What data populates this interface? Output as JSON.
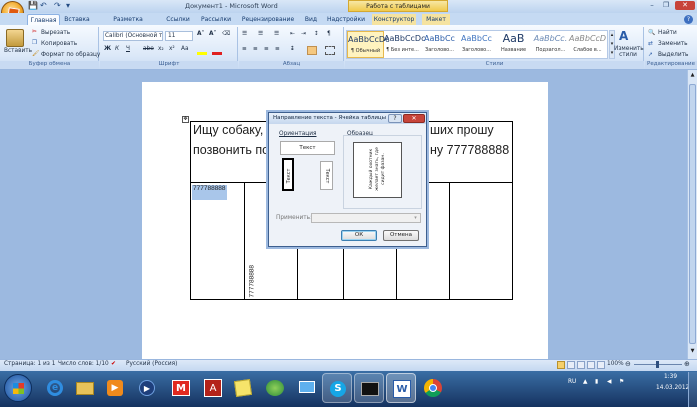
{
  "title_bar": {
    "window_title": "Документ1 - Microsoft Word",
    "context_tab_title": "Работа с таблицами",
    "minimize": "–",
    "restore": "❐",
    "close": "✕"
  },
  "ribbon_tabs": [
    "Главная",
    "Вставка",
    "Разметка страницы",
    "Ссылки",
    "Рассылки",
    "Рецензирование",
    "Вид",
    "Надстройки",
    "Конструктор",
    "Макет"
  ],
  "clipboard": {
    "paste": "Вставить",
    "cut": "Вырезать",
    "copy": "Копировать",
    "format_painter": "Формат по образцу",
    "group_label": "Буфер обмена"
  },
  "font": {
    "name": "Calibri (Основной те",
    "size": "11",
    "group_label": "Шрифт"
  },
  "paragraph": {
    "group_label": "Абзац"
  },
  "styles": {
    "items": [
      {
        "preview": "AaBbCcDc",
        "label": "¶ Обычный"
      },
      {
        "preview": "AaBbCcDc",
        "label": "¶ Без инте..."
      },
      {
        "preview": "AaBbCc",
        "label": "Заголово..."
      },
      {
        "preview": "AaBbCc",
        "label": "Заголово..."
      },
      {
        "preview": "AaB",
        "label": "Название"
      },
      {
        "preview": "AaBbCc.",
        "label": "Подзагол..."
      },
      {
        "preview": "AaBbCcD",
        "label": "Слабое в..."
      }
    ],
    "change_styles": "Изменить стили",
    "group_label": "Стили"
  },
  "editing": {
    "find": "Найти",
    "replace": "Заменить",
    "select": "Выделить",
    "group_label": "Редактирование"
  },
  "document": {
    "heading_line1": "Ищу собаку,",
    "heading_line1_right": "ших прошу",
    "heading_line2": "позвонить по",
    "heading_line2_right": "ну 777788888",
    "cell_selected": "777788888",
    "cell_vertical": "777788888"
  },
  "dialog": {
    "title": "Направление текста - Ячейка таблицы",
    "help": "?",
    "close": "✕",
    "orientation_label": "Ориентация",
    "sample_label": "Образец",
    "option_horizontal": "Текст",
    "option_up": "Текст",
    "option_down": "Текст",
    "sample_text": "Каждый охотник желает знать, где сидит фазан.",
    "apply_label": "Применить:",
    "ok": "ОК",
    "cancel": "Отмена"
  },
  "status_bar": {
    "page": "Страница: 1 из 1",
    "words": "Число слов: 1/10",
    "language": "Русский (Россия)",
    "zoom": "100%"
  },
  "taskbar": {
    "lang": "RU",
    "time": "1:39",
    "date": "14.03.2012"
  }
}
